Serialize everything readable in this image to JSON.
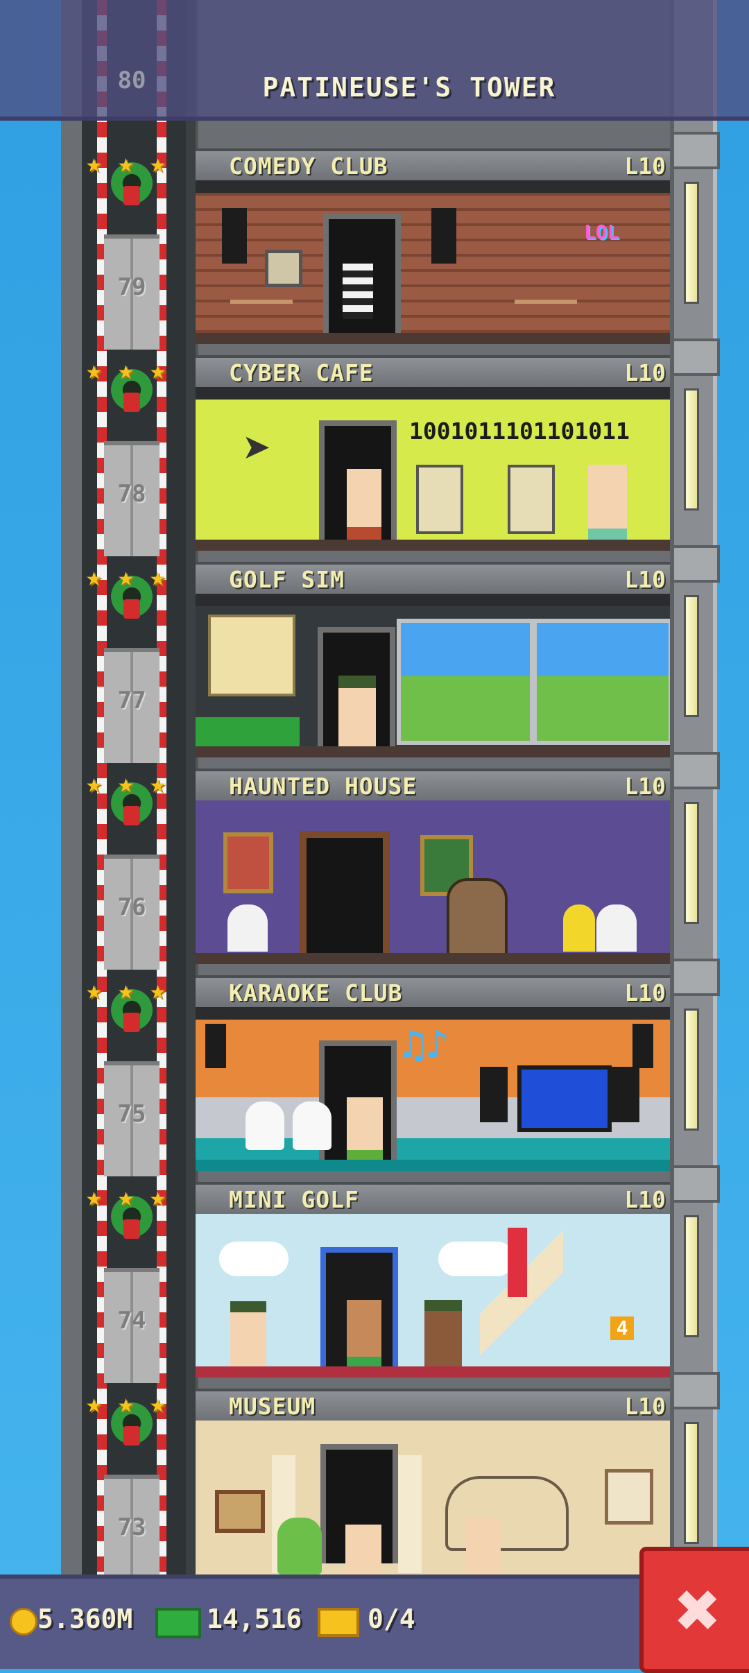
{
  "tower": {
    "title": "PATINEUSE'S TOWER",
    "top_floor_number": "80"
  },
  "floors": [
    {
      "name": "COMEDY CLUB",
      "level": "L10",
      "number": "79",
      "sign": "LOL"
    },
    {
      "name": "CYBER CAFE",
      "level": "L10",
      "number": "78",
      "screen_text": "1001011101101011"
    },
    {
      "name": "GOLF SIM",
      "level": "L10",
      "number": "77"
    },
    {
      "name": "HAUNTED HOUSE",
      "level": "L10",
      "number": "76"
    },
    {
      "name": "KARAOKE CLUB",
      "level": "L10",
      "number": "75"
    },
    {
      "name": "MINI GOLF",
      "level": "L10",
      "number": "74",
      "hole_sign": "4"
    },
    {
      "name": "MUSEUM",
      "level": "L10",
      "number": "73"
    }
  ],
  "stats": {
    "coins": "5.360M",
    "bux": "14,516",
    "tickets": "0/4"
  },
  "colors": {
    "sky": "#38a8e8",
    "header_text": "#f3eeb0",
    "close_button": "#e33838",
    "bottom_bar": "#575a86"
  },
  "icons": {
    "coin": "coin-icon",
    "cash": "cash-icon",
    "ticket": "ticket-icon",
    "close": "close-icon",
    "star": "star-icon",
    "wreath": "wreath-icon"
  }
}
